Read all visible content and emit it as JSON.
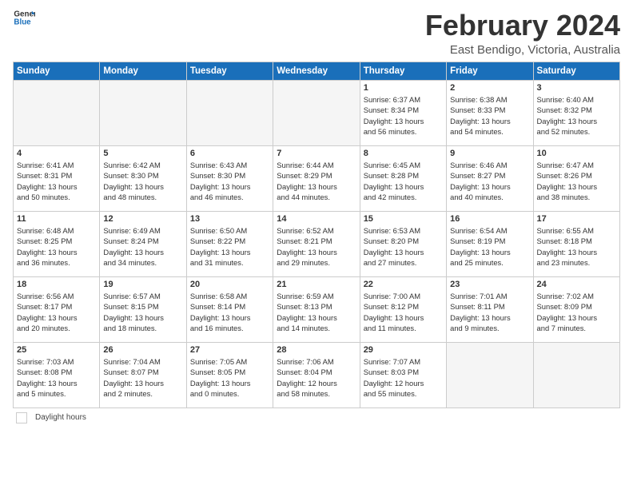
{
  "header": {
    "logo_line1": "General",
    "logo_line2": "Blue",
    "month": "February 2024",
    "location": "East Bendigo, Victoria, Australia"
  },
  "days_of_week": [
    "Sunday",
    "Monday",
    "Tuesday",
    "Wednesday",
    "Thursday",
    "Friday",
    "Saturday"
  ],
  "weeks": [
    [
      {
        "num": "",
        "info": ""
      },
      {
        "num": "",
        "info": ""
      },
      {
        "num": "",
        "info": ""
      },
      {
        "num": "",
        "info": ""
      },
      {
        "num": "1",
        "info": "Sunrise: 6:37 AM\nSunset: 8:34 PM\nDaylight: 13 hours\nand 56 minutes."
      },
      {
        "num": "2",
        "info": "Sunrise: 6:38 AM\nSunset: 8:33 PM\nDaylight: 13 hours\nand 54 minutes."
      },
      {
        "num": "3",
        "info": "Sunrise: 6:40 AM\nSunset: 8:32 PM\nDaylight: 13 hours\nand 52 minutes."
      }
    ],
    [
      {
        "num": "4",
        "info": "Sunrise: 6:41 AM\nSunset: 8:31 PM\nDaylight: 13 hours\nand 50 minutes."
      },
      {
        "num": "5",
        "info": "Sunrise: 6:42 AM\nSunset: 8:30 PM\nDaylight: 13 hours\nand 48 minutes."
      },
      {
        "num": "6",
        "info": "Sunrise: 6:43 AM\nSunset: 8:30 PM\nDaylight: 13 hours\nand 46 minutes."
      },
      {
        "num": "7",
        "info": "Sunrise: 6:44 AM\nSunset: 8:29 PM\nDaylight: 13 hours\nand 44 minutes."
      },
      {
        "num": "8",
        "info": "Sunrise: 6:45 AM\nSunset: 8:28 PM\nDaylight: 13 hours\nand 42 minutes."
      },
      {
        "num": "9",
        "info": "Sunrise: 6:46 AM\nSunset: 8:27 PM\nDaylight: 13 hours\nand 40 minutes."
      },
      {
        "num": "10",
        "info": "Sunrise: 6:47 AM\nSunset: 8:26 PM\nDaylight: 13 hours\nand 38 minutes."
      }
    ],
    [
      {
        "num": "11",
        "info": "Sunrise: 6:48 AM\nSunset: 8:25 PM\nDaylight: 13 hours\nand 36 minutes."
      },
      {
        "num": "12",
        "info": "Sunrise: 6:49 AM\nSunset: 8:24 PM\nDaylight: 13 hours\nand 34 minutes."
      },
      {
        "num": "13",
        "info": "Sunrise: 6:50 AM\nSunset: 8:22 PM\nDaylight: 13 hours\nand 31 minutes."
      },
      {
        "num": "14",
        "info": "Sunrise: 6:52 AM\nSunset: 8:21 PM\nDaylight: 13 hours\nand 29 minutes."
      },
      {
        "num": "15",
        "info": "Sunrise: 6:53 AM\nSunset: 8:20 PM\nDaylight: 13 hours\nand 27 minutes."
      },
      {
        "num": "16",
        "info": "Sunrise: 6:54 AM\nSunset: 8:19 PM\nDaylight: 13 hours\nand 25 minutes."
      },
      {
        "num": "17",
        "info": "Sunrise: 6:55 AM\nSunset: 8:18 PM\nDaylight: 13 hours\nand 23 minutes."
      }
    ],
    [
      {
        "num": "18",
        "info": "Sunrise: 6:56 AM\nSunset: 8:17 PM\nDaylight: 13 hours\nand 20 minutes."
      },
      {
        "num": "19",
        "info": "Sunrise: 6:57 AM\nSunset: 8:15 PM\nDaylight: 13 hours\nand 18 minutes."
      },
      {
        "num": "20",
        "info": "Sunrise: 6:58 AM\nSunset: 8:14 PM\nDaylight: 13 hours\nand 16 minutes."
      },
      {
        "num": "21",
        "info": "Sunrise: 6:59 AM\nSunset: 8:13 PM\nDaylight: 13 hours\nand 14 minutes."
      },
      {
        "num": "22",
        "info": "Sunrise: 7:00 AM\nSunset: 8:12 PM\nDaylight: 13 hours\nand 11 minutes."
      },
      {
        "num": "23",
        "info": "Sunrise: 7:01 AM\nSunset: 8:11 PM\nDaylight: 13 hours\nand 9 minutes."
      },
      {
        "num": "24",
        "info": "Sunrise: 7:02 AM\nSunset: 8:09 PM\nDaylight: 13 hours\nand 7 minutes."
      }
    ],
    [
      {
        "num": "25",
        "info": "Sunrise: 7:03 AM\nSunset: 8:08 PM\nDaylight: 13 hours\nand 5 minutes."
      },
      {
        "num": "26",
        "info": "Sunrise: 7:04 AM\nSunset: 8:07 PM\nDaylight: 13 hours\nand 2 minutes."
      },
      {
        "num": "27",
        "info": "Sunrise: 7:05 AM\nSunset: 8:05 PM\nDaylight: 13 hours\nand 0 minutes."
      },
      {
        "num": "28",
        "info": "Sunrise: 7:06 AM\nSunset: 8:04 PM\nDaylight: 12 hours\nand 58 minutes."
      },
      {
        "num": "29",
        "info": "Sunrise: 7:07 AM\nSunset: 8:03 PM\nDaylight: 12 hours\nand 55 minutes."
      },
      {
        "num": "",
        "info": ""
      },
      {
        "num": "",
        "info": ""
      }
    ]
  ],
  "footer": {
    "legend_label": "Daylight hours"
  }
}
